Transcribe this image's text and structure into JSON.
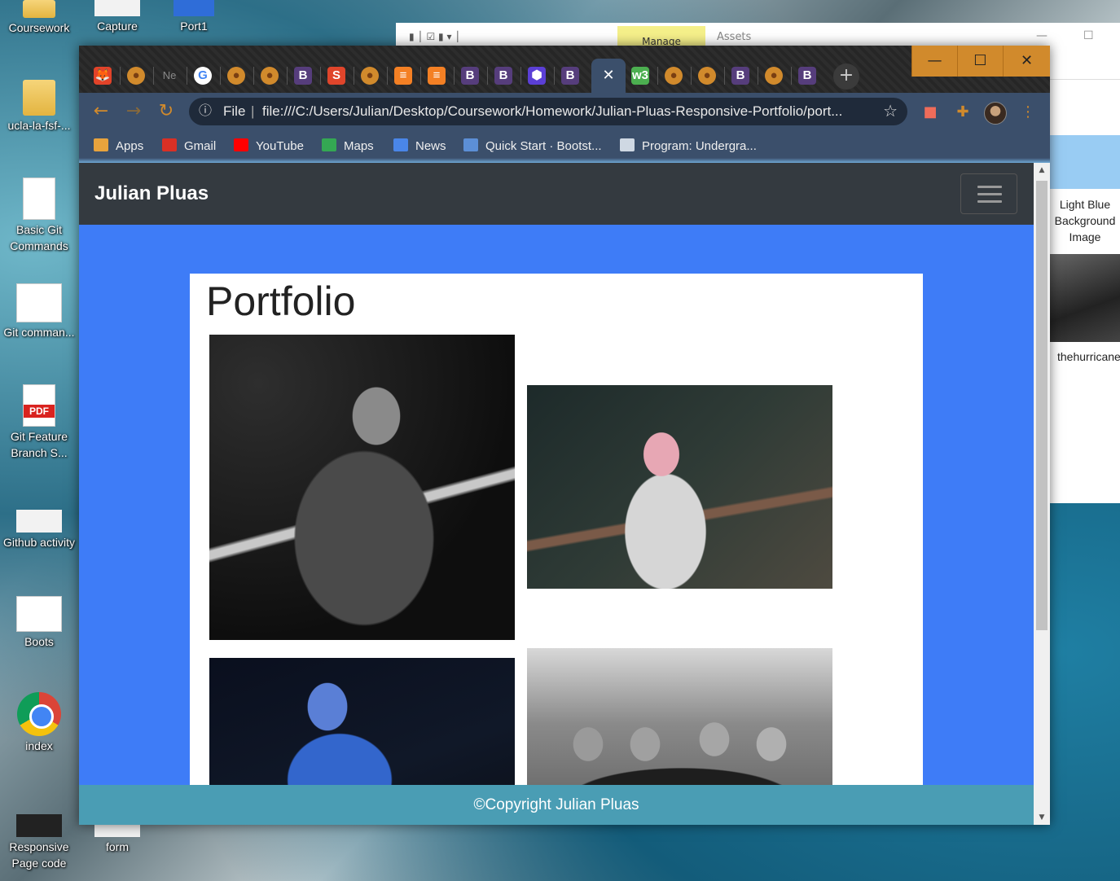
{
  "desktop": {
    "icons": [
      {
        "label": "Coursework"
      },
      {
        "label": "Capture"
      },
      {
        "label": "Port1"
      },
      {
        "label": "ucla-la-fsf-..."
      },
      {
        "label": "Basic Git Commands"
      },
      {
        "label": "Git comman..."
      },
      {
        "label": "Git Feature Branch S..."
      },
      {
        "label": "Github activity"
      },
      {
        "label": "Boots"
      },
      {
        "label": "index"
      },
      {
        "label": "Responsive Page code"
      },
      {
        "label": "form"
      }
    ],
    "pdf_badge": "PDF"
  },
  "explorer": {
    "manage_tab": "Manage",
    "assets_tab": "Assets",
    "item_label": "Light Blue Background Image",
    "item2_label": "thehurricane"
  },
  "browser": {
    "tabs": [
      {
        "icon": "gitlab-icon",
        "color": "#e24329",
        "glyph": "🦊"
      },
      {
        "icon": "firefox-icon",
        "color": "#d18a2c",
        "glyph": "●"
      },
      {
        "icon": "new-tab-icon",
        "color": "#555555",
        "glyph": "Ne"
      },
      {
        "icon": "google-icon",
        "color": "#ffffff",
        "glyph": "G"
      },
      {
        "icon": "firefox-icon",
        "color": "#d18a2c",
        "glyph": "●"
      },
      {
        "icon": "firefox-icon",
        "color": "#d18a2c",
        "glyph": "●"
      },
      {
        "icon": "bootstrap-icon",
        "color": "#563d7c",
        "glyph": "B"
      },
      {
        "icon": "sololearn-icon",
        "color": "#e0452b",
        "glyph": "S"
      },
      {
        "icon": "firefox-icon",
        "color": "#d18a2c",
        "glyph": "●"
      },
      {
        "icon": "stackoverflow-icon",
        "color": "#f48024",
        "glyph": "≡"
      },
      {
        "icon": "stackoverflow-icon",
        "color": "#f48024",
        "glyph": "≡"
      },
      {
        "icon": "bootstrap-icon",
        "color": "#563d7c",
        "glyph": "B"
      },
      {
        "icon": "bootstrap-icon",
        "color": "#563d7c",
        "glyph": "B"
      },
      {
        "icon": "hexagon-icon",
        "color": "#5b3fd6",
        "glyph": "⬢"
      },
      {
        "icon": "bootstrap-icon",
        "color": "#563d7c",
        "glyph": "B"
      },
      {
        "icon": "w3schools-icon",
        "color": "#4caf50",
        "glyph": "w3"
      },
      {
        "icon": "firefox-icon",
        "color": "#d18a2c",
        "glyph": "●"
      },
      {
        "icon": "firefox-icon",
        "color": "#d18a2c",
        "glyph": "●"
      },
      {
        "icon": "bootstrap-icon",
        "color": "#563d7c",
        "glyph": "B"
      },
      {
        "icon": "firefox-icon",
        "color": "#d18a2c",
        "glyph": "●"
      },
      {
        "icon": "bootstrap-icon",
        "color": "#563d7c",
        "glyph": "B"
      }
    ],
    "active_tab_close": "✕",
    "new_tab": "+",
    "window_controls": {
      "minimize": "—",
      "maximize": "☐",
      "close": "✕"
    },
    "address": {
      "scheme_label": "File",
      "url": "file:///C:/Users/Julian/Desktop/Coursework/Homework/Julian-Pluas-Responsive-Portfolio/port..."
    },
    "bookmarks": [
      {
        "label": "Apps",
        "icon": "apps-grid-icon",
        "color": "#e8a33d"
      },
      {
        "label": "Gmail",
        "icon": "gmail-icon",
        "color": "#d93025"
      },
      {
        "label": "YouTube",
        "icon": "youtube-icon",
        "color": "#ff0000"
      },
      {
        "label": "Maps",
        "icon": "maps-icon",
        "color": "#34a853"
      },
      {
        "label": "News",
        "icon": "news-icon",
        "color": "#4a86e8"
      },
      {
        "label": "Quick Start · Bootst...",
        "icon": "bootstrap-icon",
        "color": "#5c8fd6"
      },
      {
        "label": "Program: Undergra...",
        "icon": "program-icon",
        "color": "#cfd8e3"
      }
    ]
  },
  "page": {
    "brand": "Julian Pluas",
    "title": "Portfolio",
    "footer": "©Copyright Julian Pluas",
    "colors": {
      "background": "#3e7cf7",
      "navbar": "#343a40",
      "footer": "#4a9db4"
    },
    "photos": [
      {
        "name": "singer-guitarist-photo"
      },
      {
        "name": "bassist-photo"
      },
      {
        "name": "blue-stage-photo"
      },
      {
        "name": "band-group-photo"
      }
    ]
  }
}
